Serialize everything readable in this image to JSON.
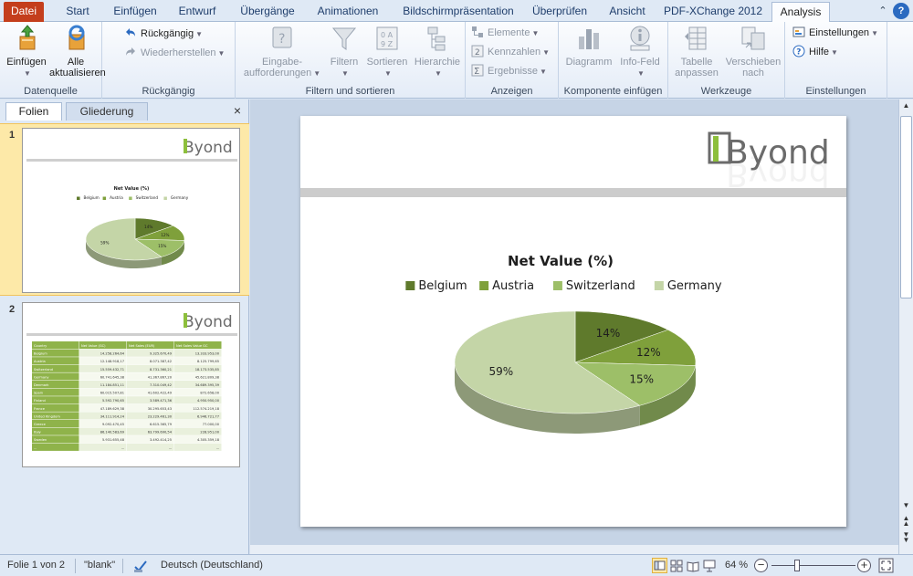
{
  "tabs": [
    "Datei",
    "Start",
    "Einfügen",
    "Entwurf",
    "Übergänge",
    "Animationen",
    "Bildschirmpräsentation",
    "Überprüfen",
    "Ansicht",
    "PDF-XChange 2012",
    "Analysis"
  ],
  "window_controls": {
    "minimize": "⌃",
    "help": "?"
  },
  "ribbon": {
    "datenquelle": {
      "label": "Datenquelle",
      "einfuegen": "Einfügen",
      "alle": "Alle",
      "aktualisieren": "aktualisieren"
    },
    "rueckgaengig": {
      "label": "Rückgängig",
      "undo": "Rückgängig",
      "redo": "Wiederherstellen"
    },
    "filtern": {
      "label": "Filtern und sortieren",
      "eingabe1": "Eingabe-",
      "eingabe2": "aufforderungen",
      "filtern": "Filtern",
      "sortieren": "Sortieren",
      "hierarchie": "Hierarchie"
    },
    "anzeigen": {
      "label": "Anzeigen",
      "elemente": "Elemente",
      "kennzahlen": "Kennzahlen",
      "ergebnisse": "Ergebnisse"
    },
    "komponente": {
      "label": "Komponente einfügen",
      "diagramm": "Diagramm",
      "infofeld": "Info-Feld"
    },
    "werkzeuge": {
      "label": "Werkzeuge",
      "tabelle1": "Tabelle",
      "tabelle2": "anpassen",
      "verschieben1": "Verschieben",
      "verschieben2": "nach"
    },
    "einstellungen": {
      "label": "Einstellungen",
      "einstellungen": "Einstellungen",
      "hilfe": "Hilfe"
    }
  },
  "panel": {
    "tab_folien": "Folien",
    "tab_gliederung": "Gliederung",
    "close": "×",
    "slide1_num": "1",
    "slide2_num": "2"
  },
  "logo": {
    "brand": "Byond"
  },
  "chart_data": {
    "type": "pie",
    "title": "Net Value (%)",
    "categories": [
      "Belgium",
      "Austria",
      "Switzerland",
      "Germany"
    ],
    "values": [
      14,
      12,
      15,
      59
    ],
    "labels": [
      "14%",
      "12%",
      "15%",
      "59%"
    ],
    "colors": [
      "#5f7a2c",
      "#7fa03b",
      "#9dbf68",
      "#c4d5a7"
    ],
    "legend_position": "top"
  },
  "thumb_table": {
    "headers": [
      "Country",
      "Net Value (GC)",
      "Net Sales (EUR)",
      "Net Sales Value GC"
    ],
    "rows": [
      [
        "Belgium",
        "14.258.264,64",
        "9.325.670,49",
        "13.333.953,00"
      ],
      [
        "Austria",
        "12.148.918,17",
        "8.071.387,42",
        "8.125.799,65"
      ],
      [
        "Switzerland",
        "15.559.432,71",
        "8.731.360,21",
        "18.173.535,85"
      ],
      [
        "Germany",
        "60.741.645,38",
        "41.367.867,20",
        "45.621.809,38"
      ],
      [
        "Denmark",
        "11.184.851,11",
        "7.310.049,42",
        "34.689.395,39"
      ],
      [
        "Spain",
        "60.015.507,81",
        "41.602.422,49",
        "872.658,00"
      ],
      [
        "Finland",
        "5.592.790,65",
        "3.589.471,36",
        "4.950.950,00"
      ],
      [
        "France",
        "47.189.629,38",
        "30.295.653,43",
        "112.574.219,18"
      ],
      [
        "United Kingdom",
        "34.111.914,24",
        "23.229.461,30",
        "6.946.721,77"
      ],
      [
        "Greece",
        "9.092.470,45",
        "6.615.365,79",
        "77.000,00"
      ],
      [
        "Italy",
        "86.140.583,69",
        "63.799.690,54",
        "228.951,00"
      ],
      [
        "Sweden",
        "5.931.655,48",
        "3.492.414,25",
        "4.305.359,18"
      ],
      [
        "...",
        "...",
        "...",
        "..."
      ]
    ]
  },
  "statusbar": {
    "slide": "Folie 1 von 2",
    "theme": "\"blank\"",
    "language": "Deutsch (Deutschland)",
    "zoom": "64 %",
    "zoom_fraction": 0.64,
    "minus": "−",
    "plus": "+"
  }
}
